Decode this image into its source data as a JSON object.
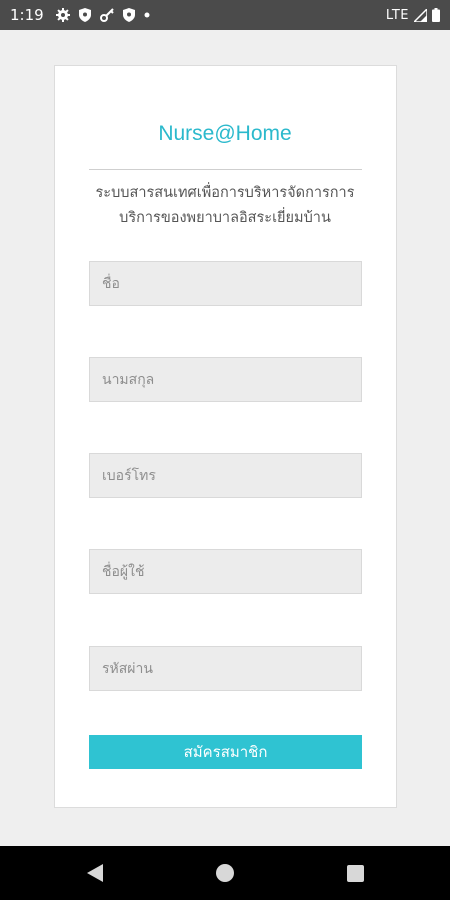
{
  "status_bar": {
    "time": "1:19",
    "network": "LTE",
    "icons": [
      "gear-icon",
      "shield-icon",
      "key-icon",
      "shield-icon",
      "dot-icon",
      "signal-icon",
      "battery-icon"
    ]
  },
  "form": {
    "title": "Nurse@Home",
    "subtitle_line1": "ระบบสารสนเทศเพื่อการบริหารจัดการการ",
    "subtitle_line2": "บริการของพยาบาลอิสระเยี่ยมบ้าน",
    "fields": [
      {
        "placeholder": "ชื่อ"
      },
      {
        "placeholder": "นามสกุล"
      },
      {
        "placeholder": "เบอร์โทร"
      },
      {
        "placeholder": "ชื่อผู้ใช้"
      },
      {
        "placeholder": "รหัสผ่าน"
      }
    ],
    "submit_label": "สมัครสมาชิก"
  },
  "nav_bar": {
    "buttons": [
      "back-icon",
      "home-icon",
      "recents-icon"
    ]
  },
  "colors": {
    "accent": "#2bb9cc",
    "button": "#2fc3d2",
    "status_bar": "#4b4b4b",
    "background": "#efefef"
  }
}
